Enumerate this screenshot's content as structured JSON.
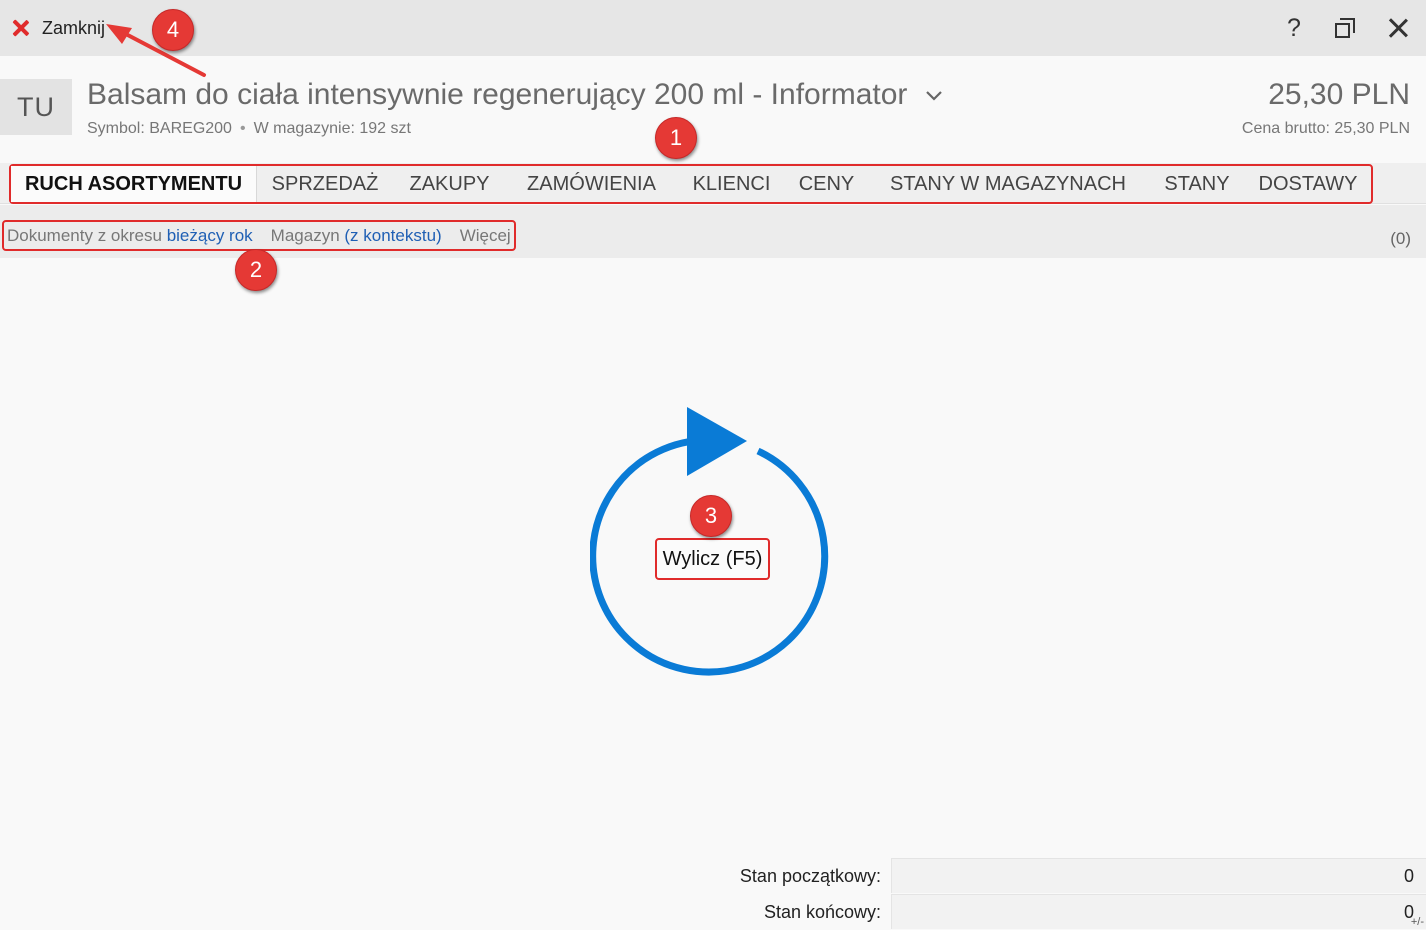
{
  "window": {
    "close_label": "Zamknij",
    "help_label": "?"
  },
  "header": {
    "avatar": "TU",
    "title": "Balsam do ciała intensywnie regenerujący 200 ml - Informator",
    "symbol": "Symbol: BAREG200",
    "stock": "W magazynie: 192 szt",
    "separator": "•",
    "price": "25,30 PLN",
    "gross_price": "Cena brutto: 25,30 PLN"
  },
  "tabs": [
    {
      "label": "RUCH ASORTYMENTU",
      "active": true
    },
    {
      "label": "SPRZEDAŻ",
      "active": false
    },
    {
      "label": "ZAKUPY",
      "active": false
    },
    {
      "label": "ZAMÓWIENIA",
      "active": false
    },
    {
      "label": "KLIENCI",
      "active": false
    },
    {
      "label": "CENY",
      "active": false
    },
    {
      "label": "STANY W MAGAZYNACH",
      "active": false
    },
    {
      "label": "STANY",
      "active": false
    },
    {
      "label": "DOSTAWY",
      "active": false
    }
  ],
  "filters": {
    "period_prefix": "Dokumenty z okresu",
    "period_value": "bieżący rok",
    "warehouse_prefix": "Magazyn",
    "warehouse_value": "(z kontekstu)",
    "more": "Więcej",
    "count": "(0)"
  },
  "content": {
    "compute_button": "Wylicz (F5)"
  },
  "totals": {
    "start_label": "Stan początkowy:",
    "start_value": "0",
    "end_label": "Stan końcowy:",
    "end_value": "0",
    "end_marker": "+/-"
  },
  "annotations": {
    "badge_1": "1",
    "badge_2": "2",
    "badge_3": "3",
    "badge_4": "4"
  },
  "colors": {
    "accent_blue": "#0a7bd6",
    "highlight_red": "#e02b2b",
    "link_blue": "#1f5fb4"
  }
}
